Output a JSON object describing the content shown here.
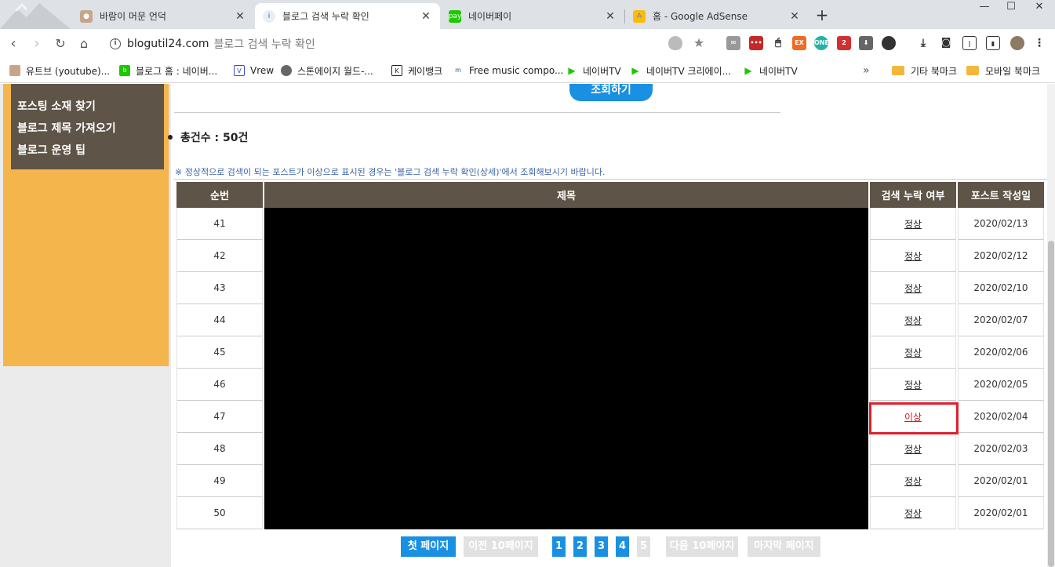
{
  "tabs": [
    {
      "title": "바람이 머문 언덕",
      "favicon": "avatar-icon"
    },
    {
      "title": "블로그 검색 누락 확인",
      "favicon": "blog-icon"
    },
    {
      "title": "네이버페이",
      "favicon": "naverpay-icon"
    },
    {
      "title": "홈 - Google AdSense",
      "favicon": "adsense-icon"
    }
  ],
  "toolbar": {
    "url": "blogutil24.com",
    "page_title": "블로그 검색 누락 확인"
  },
  "bookmarks": [
    "유트브 (youtube)...",
    "블로그 홈 : 네이버...",
    "Vrew",
    "스톤에이지 월드-...",
    "케이뱅크",
    "Free music compo...",
    "네이버TV",
    "네이버TV 크리에이...",
    "네이버TV",
    "기타 북마크",
    "모바일 북마크"
  ],
  "sidebar": {
    "items": [
      "포스팅 소재 찾기",
      "블로그 제목 가져오기",
      "블로그 운영 팁"
    ]
  },
  "main": {
    "search_button": "조회하기",
    "total": "총건수 : 50건",
    "notice": "※ 정상적으로 검색이 되는 포스트가 이상으로 표시된 경우는 '블로그 검색 누락 확인(상세)'에서 조회해보시기 바랍니다.",
    "table": {
      "headers": [
        "순번",
        "제목",
        "검색 누락 여부",
        "포스트 작성일"
      ],
      "rows": [
        {
          "no": "41",
          "status": "정상",
          "date": "2020/02/13"
        },
        {
          "no": "42",
          "status": "정상",
          "date": "2020/02/12"
        },
        {
          "no": "43",
          "status": "정상",
          "date": "2020/02/10"
        },
        {
          "no": "44",
          "status": "정상",
          "date": "2020/02/07"
        },
        {
          "no": "45",
          "status": "정상",
          "date": "2020/02/06"
        },
        {
          "no": "46",
          "status": "정상",
          "date": "2020/02/05"
        },
        {
          "no": "47",
          "status": "이상",
          "date": "2020/02/04"
        },
        {
          "no": "48",
          "status": "정상",
          "date": "2020/02/03"
        },
        {
          "no": "49",
          "status": "정상",
          "date": "2020/02/01"
        },
        {
          "no": "50",
          "status": "정상",
          "date": "2020/02/01"
        }
      ]
    },
    "pager": {
      "first": "첫 페이지",
      "prev": "이전 10페이지",
      "pages": [
        "1",
        "2",
        "3",
        "4",
        "5"
      ],
      "next": "다음 10페이지",
      "last": "마지막 페이지"
    }
  },
  "colors": {
    "accent": "#1a90e3",
    "header_bg": "#5e5447",
    "sidebar_bg": "#f5b54d",
    "error": "#d61c2a"
  }
}
